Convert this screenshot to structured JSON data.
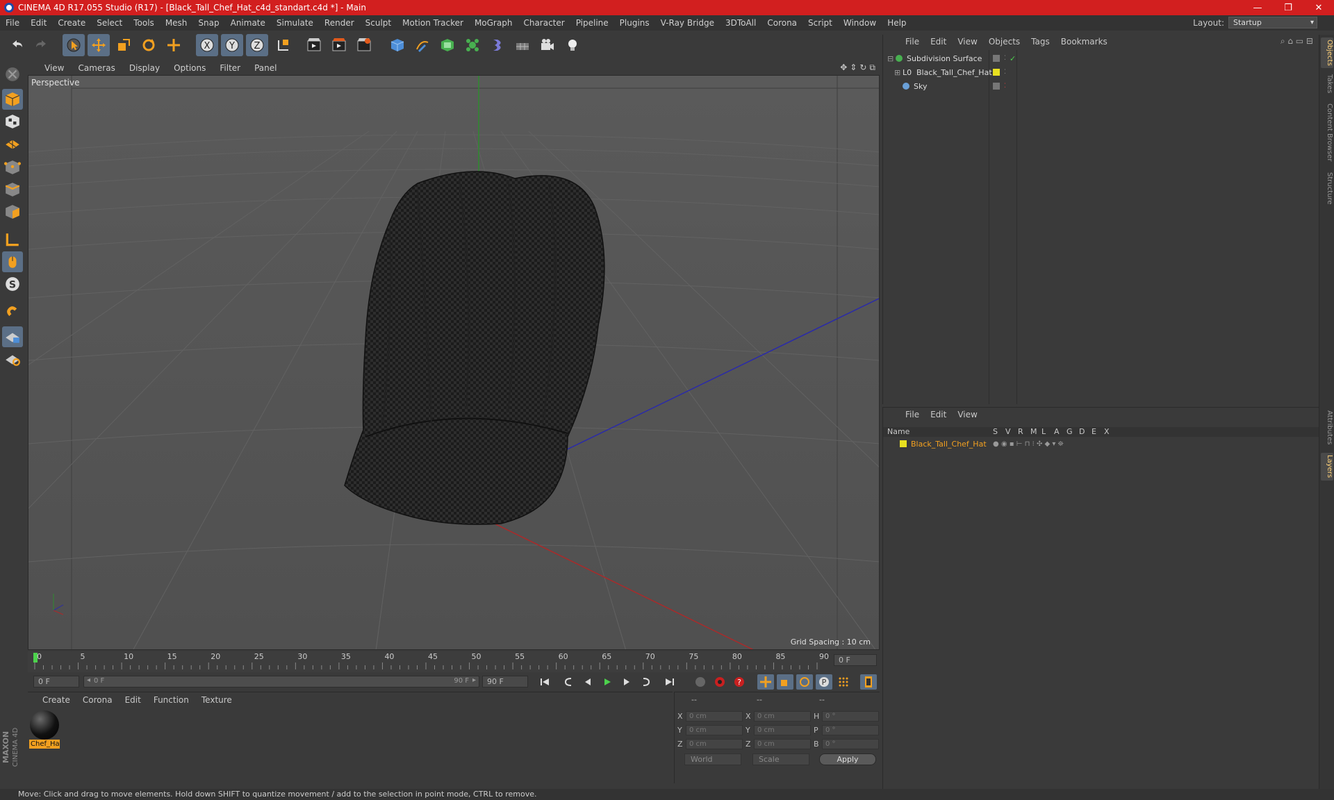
{
  "window": {
    "title": "CINEMA 4D R17.055 Studio (R17) - [Black_Tall_Chef_Hat_c4d_standart.c4d *] - Main",
    "controls": [
      "—",
      "❐",
      "✕"
    ]
  },
  "menubar": {
    "items": [
      "File",
      "Edit",
      "Create",
      "Select",
      "Tools",
      "Mesh",
      "Snap",
      "Animate",
      "Simulate",
      "Render",
      "Sculpt",
      "Motion Tracker",
      "MoGraph",
      "Character",
      "Pipeline",
      "Plugins",
      "V-Ray Bridge",
      "3DToAll",
      "Corona",
      "Script",
      "Window",
      "Help"
    ],
    "layout_label": "Layout:",
    "layout_value": "Startup"
  },
  "toolbar": {
    "axis_x": "X",
    "axis_y": "Y",
    "axis_z": "Z"
  },
  "viewport": {
    "menu": [
      "View",
      "Cameras",
      "Display",
      "Options",
      "Filter",
      "Panel"
    ],
    "label": "Perspective",
    "grid_spacing": "Grid Spacing : 10 cm"
  },
  "timeline": {
    "ticks": [
      "0",
      "5",
      "10",
      "15",
      "20",
      "25",
      "30",
      "35",
      "40",
      "45",
      "50",
      "55",
      "60",
      "65",
      "70",
      "75",
      "80",
      "85",
      "90"
    ],
    "current_frame": "0 F",
    "start_field": "0 F",
    "range_start": "0 F",
    "range_end": "90 F",
    "end_field": "90 F"
  },
  "material_manager": {
    "menu": [
      "Create",
      "Corona",
      "Edit",
      "Function",
      "Texture"
    ],
    "materials": [
      {
        "name": "Chef_Ha"
      }
    ]
  },
  "coordinates": {
    "header": [
      "--",
      "--",
      "--"
    ],
    "rows": [
      {
        "l1": "X",
        "v1": "0 cm",
        "l2": "X",
        "v2": "0 cm",
        "l3": "H",
        "v3": "0 °"
      },
      {
        "l1": "Y",
        "v1": "0 cm",
        "l2": "Y",
        "v2": "0 cm",
        "l3": "P",
        "v3": "0 °"
      },
      {
        "l1": "Z",
        "v1": "0 cm",
        "l2": "Z",
        "v2": "0 cm",
        "l3": "B",
        "v3": "0 °"
      }
    ],
    "mode1": "World",
    "mode2": "Scale",
    "apply": "Apply"
  },
  "object_manager": {
    "menu": [
      "File",
      "Edit",
      "View",
      "Objects",
      "Tags",
      "Bookmarks"
    ],
    "objects": [
      {
        "name": "Subdivision Surface"
      },
      {
        "name": "Black_Tall_Chef_Hat"
      },
      {
        "name": "Sky"
      }
    ]
  },
  "layer_manager": {
    "menu": [
      "File",
      "Edit",
      "View"
    ],
    "columns": [
      "Name",
      "S",
      "V",
      "R",
      "M",
      "L",
      "A",
      "G",
      "D",
      "E",
      "X"
    ],
    "layers": [
      {
        "name": "Black_Tall_Chef_Hat"
      }
    ]
  },
  "right_tabs": [
    "Objects",
    "Takes",
    "Content Browser",
    "Structure",
    "Attributes",
    "Layers"
  ],
  "brand": "MAXON CINEMA 4D",
  "status": "Move: Click and drag to move elements. Hold down SHIFT to quantize movement / add to the selection in point mode, CTRL to remove.",
  "colors": {
    "titlebar": "#d21f1f",
    "accent": "#f2a020",
    "active_tool": "#5b6f86"
  }
}
